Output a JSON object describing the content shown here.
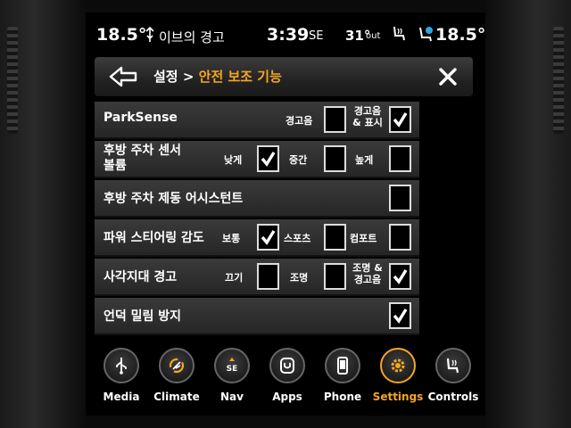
{
  "status": {
    "left_temp": "18.5°",
    "notice": "이브의 경고",
    "time": "3:39",
    "heading": "SE",
    "outside_temp": "31°",
    "outside_label": "out",
    "right_temp": "18.5°"
  },
  "header": {
    "breadcrumb": "설정 >",
    "title": "안전 보조 기능"
  },
  "settings": [
    {
      "label": "ParkSense",
      "options": [
        {
          "label": "경고음",
          "checked": false
        },
        {
          "label": "경고음\n& 표시",
          "checked": true
        }
      ]
    },
    {
      "label": "후방 주차 센서\n볼륨",
      "options": [
        {
          "label": "낮게",
          "checked": true
        },
        {
          "label": "중간",
          "checked": false
        },
        {
          "label": "높게",
          "checked": false
        }
      ]
    },
    {
      "label": "후방 주차 제동 어시스턴트",
      "options": [
        {
          "label": "",
          "checked": false
        }
      ]
    },
    {
      "label": "파워 스티어링 감도",
      "options": [
        {
          "label": "보통",
          "checked": true
        },
        {
          "label": "스포츠",
          "checked": false
        },
        {
          "label": "컴포트",
          "checked": false
        }
      ]
    },
    {
      "label": "사각지대 경고",
      "options": [
        {
          "label": "끄기",
          "checked": false
        },
        {
          "label": "조명",
          "checked": false
        },
        {
          "label": "조명 &\n경고음",
          "checked": true
        }
      ]
    },
    {
      "label": "언덕 밀림 방지",
      "options": [
        {
          "label": "",
          "checked": true
        }
      ]
    }
  ],
  "dock": [
    {
      "label": "Media",
      "icon": "usb-icon",
      "active": false
    },
    {
      "label": "Climate",
      "icon": "climate-icon",
      "active": false
    },
    {
      "label": "Nav",
      "icon": "compass-icon",
      "active": false
    },
    {
      "label": "Apps",
      "icon": "apps-icon",
      "active": false
    },
    {
      "label": "Phone",
      "icon": "phone-icon",
      "active": false
    },
    {
      "label": "Settings",
      "icon": "gear-icon",
      "active": true
    },
    {
      "label": "Controls",
      "icon": "seat-icon",
      "active": false
    }
  ],
  "nav_compass_label": "SE",
  "colors": {
    "accent": "#f5a623",
    "text": "#ffffff",
    "row_bg": "#303030"
  }
}
